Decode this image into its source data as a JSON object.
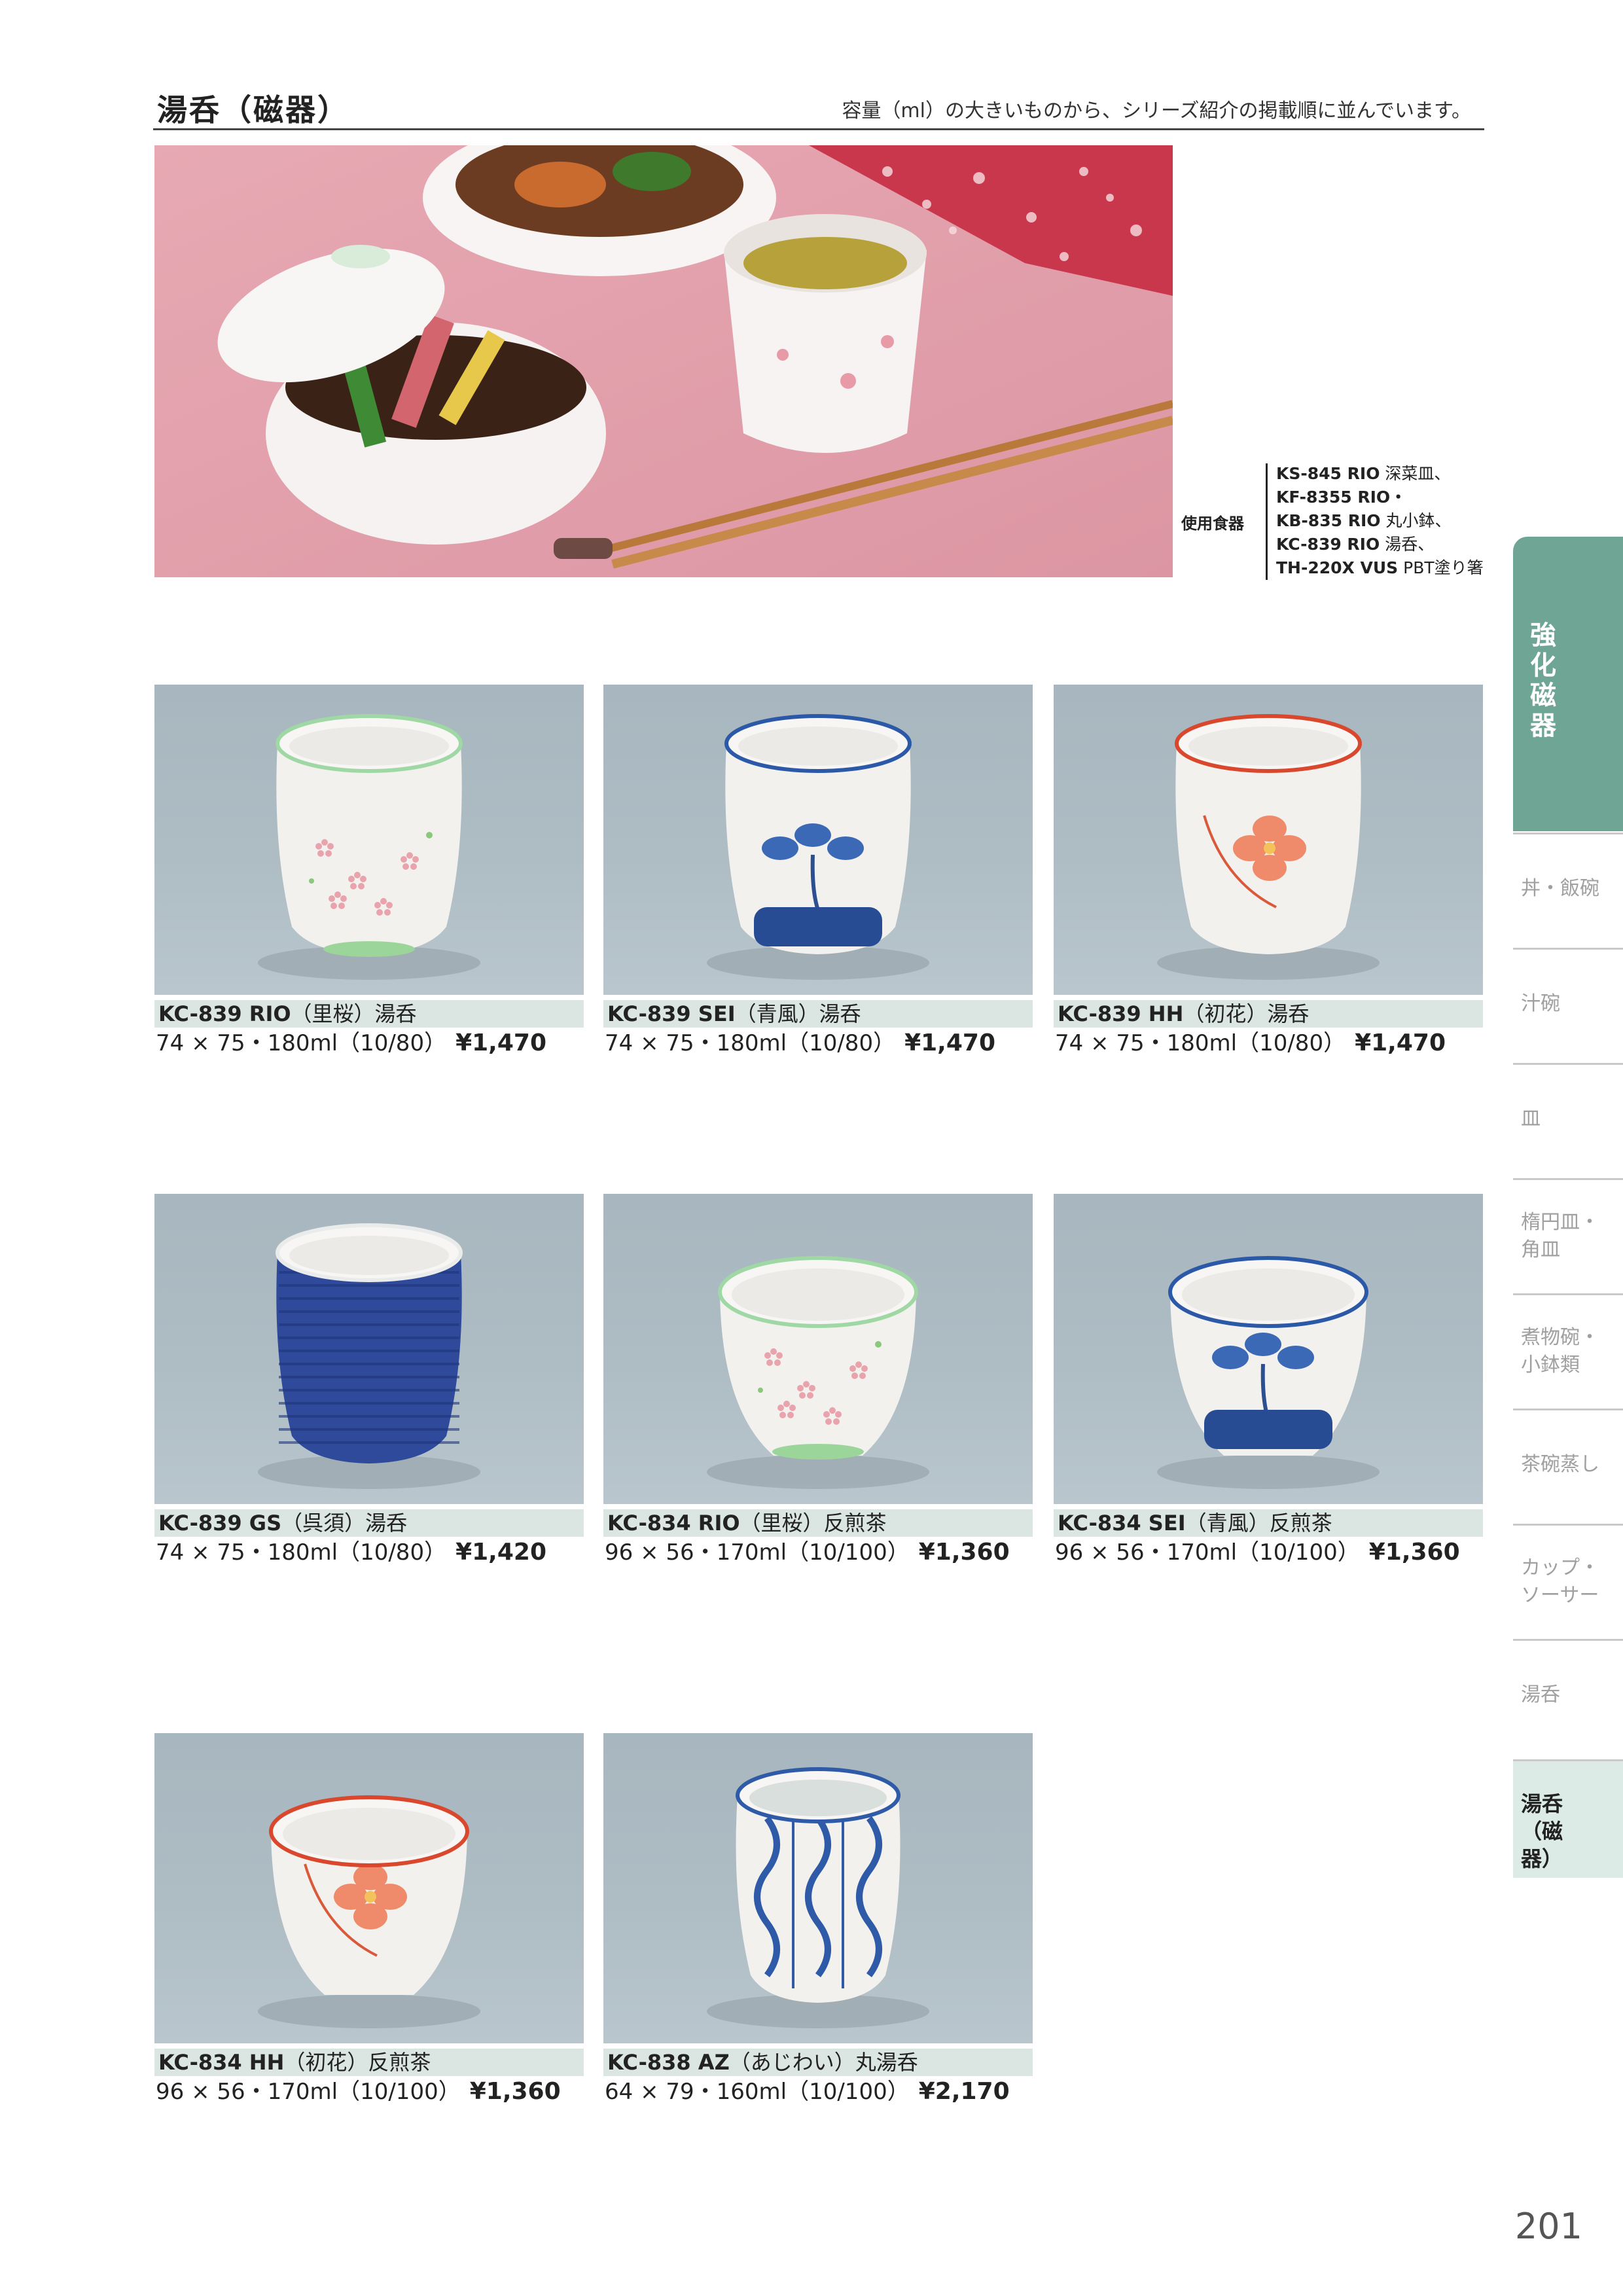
{
  "header": {
    "title": "湯呑（磁器）",
    "note": "容量（ml）の大きいものから、シリーズ紹介の掲載順に並んでいます。"
  },
  "usage": {
    "label": "使用食器",
    "items": [
      {
        "code": "KS-845 RIO",
        "desc": "深菜皿、"
      },
      {
        "code": "KF-8355 RIO・",
        "desc": ""
      },
      {
        "code": "KB-835 RIO",
        "desc": "丸小鉢、"
      },
      {
        "code": "KC-839 RIO",
        "desc": "湯呑、"
      },
      {
        "code": "TH-220X VUS",
        "desc": "PBT塗り箸"
      }
    ]
  },
  "products": [
    {
      "code": "KC-839 RIO",
      "name": "（里桜）湯呑",
      "spec": "74 × 75・180ml（10/80）",
      "price": "¥1,470",
      "pattern": "pink-sakura",
      "shape": "tall"
    },
    {
      "code": "KC-839 SEI",
      "name": "（青風）湯呑",
      "spec": "74 × 75・180ml（10/80）",
      "price": "¥1,470",
      "pattern": "blue-flower",
      "shape": "tall"
    },
    {
      "code": "KC-839 HH",
      "name": "（初花）湯呑",
      "spec": "74 × 75・180ml（10/80）",
      "price": "¥1,470",
      "pattern": "orange-flower",
      "shape": "tall"
    },
    {
      "code": "KC-839 GS",
      "name": "（呉須）湯呑",
      "spec": "74 × 75・180ml（10/80）",
      "price": "¥1,420",
      "pattern": "cobalt",
      "shape": "tall"
    },
    {
      "code": "KC-834 RIO",
      "name": "（里桜）反煎茶",
      "spec": "96 × 56・170ml（10/100）",
      "price": "¥1,360",
      "pattern": "pink-sakura",
      "shape": "bowl"
    },
    {
      "code": "KC-834 SEI",
      "name": "（青風）反煎茶",
      "spec": "96 × 56・170ml（10/100）",
      "price": "¥1,360",
      "pattern": "blue-flower",
      "shape": "bowl"
    },
    {
      "code": "KC-834 HH",
      "name": "（初花）反煎茶",
      "spec": "96 × 56・170ml（10/100）",
      "price": "¥1,360",
      "pattern": "orange-flower",
      "shape": "bowl"
    },
    {
      "code": "KC-838 AZ",
      "name": "（あじわい）丸湯呑",
      "spec": "64 × 79・160ml（10/100）",
      "price": "¥2,170",
      "pattern": "blue-arabesque",
      "shape": "round"
    }
  ],
  "sidebar": {
    "main_tab": "強化磁器",
    "items": [
      "丼・飯碗",
      "汁碗",
      "皿",
      "楕円皿・角皿",
      "煮物碗・小鉢類",
      "茶碗蒸し",
      "カップ・ソーサー",
      "湯呑"
    ],
    "active": "湯呑（磁器）"
  },
  "page_number": "201"
}
